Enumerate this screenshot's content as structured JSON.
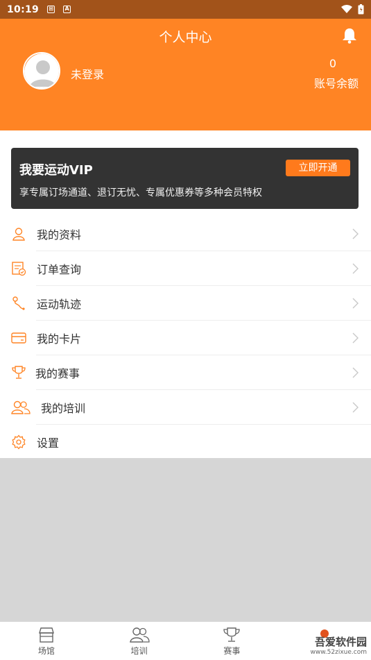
{
  "status_bar": {
    "time": "10:19",
    "icon_a": "A"
  },
  "header": {
    "title": "个人中心",
    "login_status": "未登录",
    "balance_amount": "0",
    "balance_label": "账号余额"
  },
  "vip": {
    "title": "我要运动VIP",
    "description": "享专属订场通道、退订无忧、专属优惠券等多种会员特权",
    "button": "立即开通"
  },
  "menu": [
    {
      "label": "我的资料",
      "icon": "user-icon"
    },
    {
      "label": "订单查询",
      "icon": "order-icon"
    },
    {
      "label": "运动轨迹",
      "icon": "track-icon"
    },
    {
      "label": "我的卡片",
      "icon": "card-icon"
    },
    {
      "label": "我的赛事",
      "icon": "trophy-icon"
    },
    {
      "label": "我的培训",
      "icon": "users-icon"
    },
    {
      "label": "设置",
      "icon": "settings-icon"
    }
  ],
  "tabs": [
    {
      "label": "场馆",
      "icon": "store-icon"
    },
    {
      "label": "培训",
      "icon": "users-icon"
    },
    {
      "label": "赛事",
      "icon": "trophy-icon"
    },
    {
      "label": "",
      "icon": ""
    }
  ],
  "watermark": {
    "main": "吾爱软件园",
    "url": "www.52zixue.com"
  },
  "colors": {
    "accent": "#ff8424",
    "status_bar": "#a2531a",
    "vip_bg": "#333333",
    "vip_button": "#ff7a1c"
  }
}
